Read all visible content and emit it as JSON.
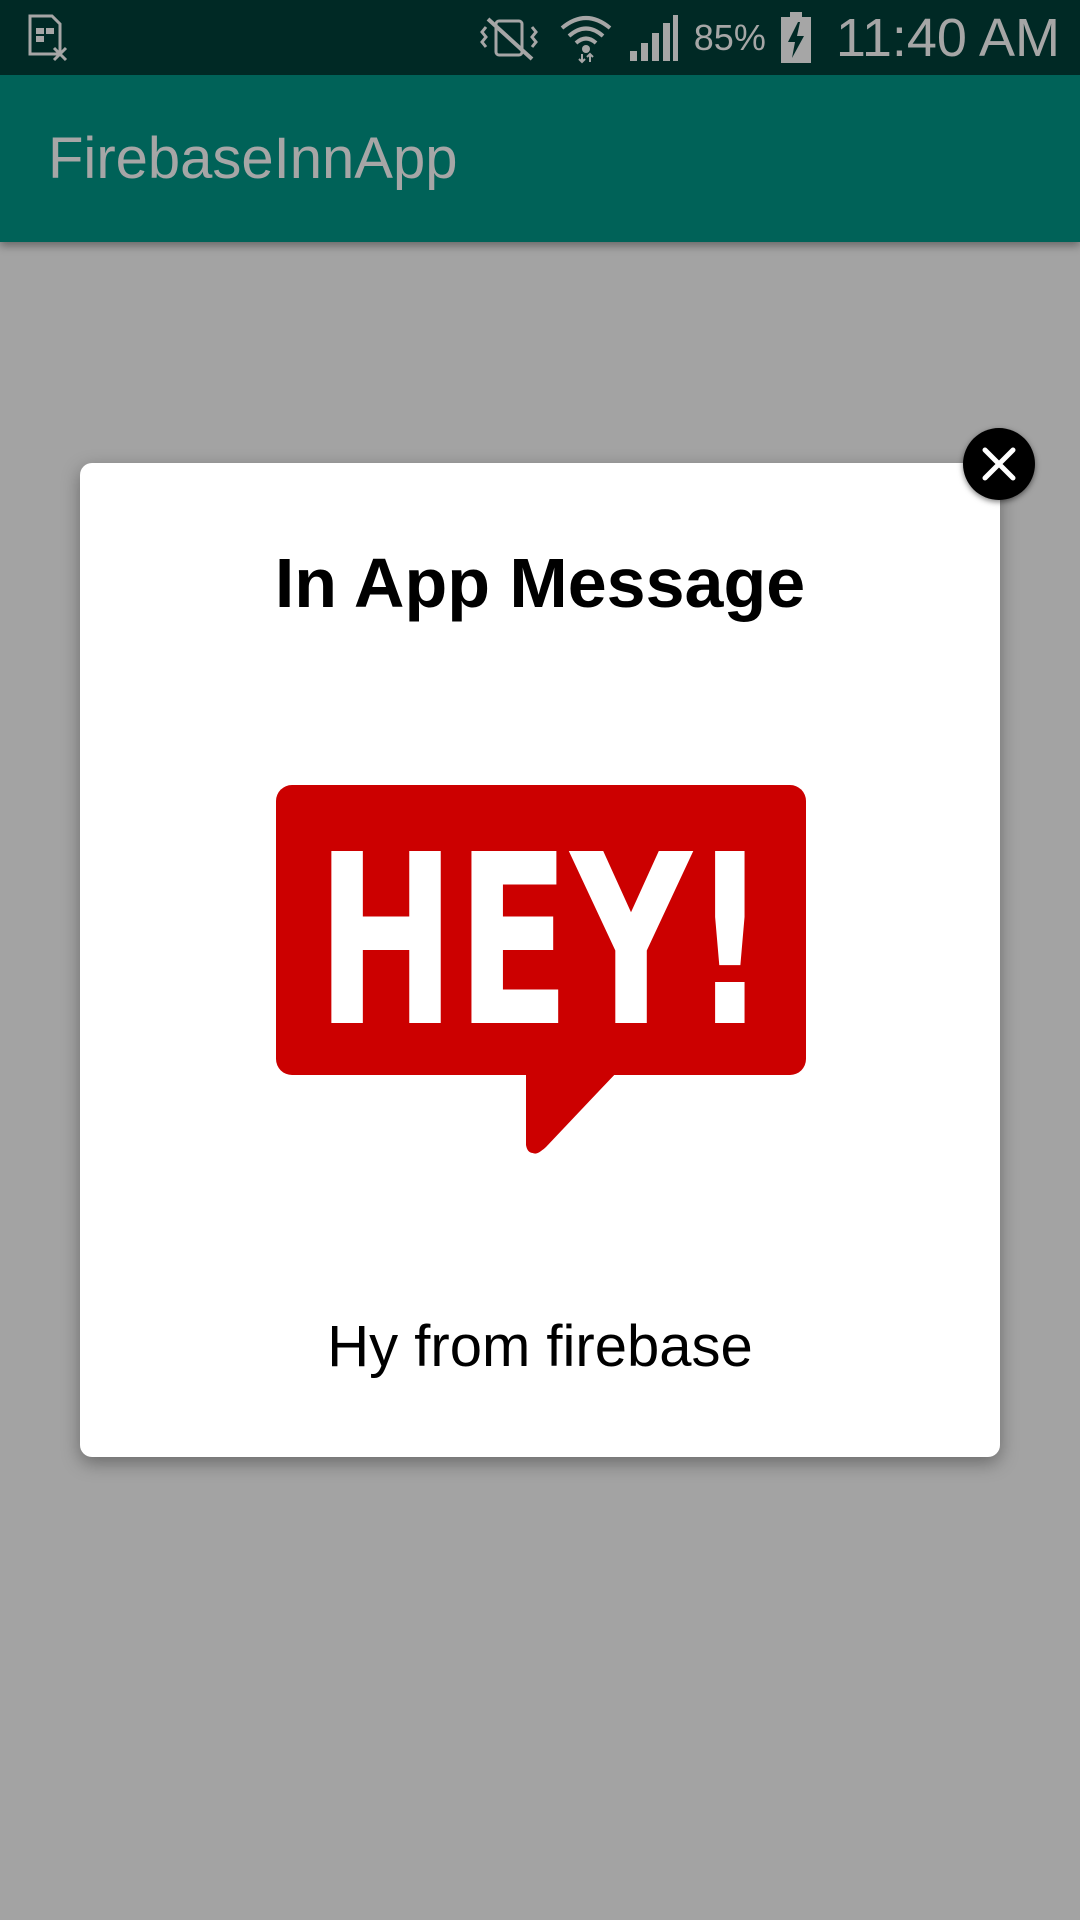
{
  "status_bar": {
    "battery_percent": "85%",
    "time": "11:40 AM",
    "icons": [
      "sim-error-icon",
      "vibrate-mute-icon",
      "wifi-icon",
      "signal-icon",
      "battery-charging-icon"
    ]
  },
  "app_bar": {
    "title": "FirebaseInnApp",
    "color": "#009788"
  },
  "in_app_message": {
    "title": "In App Message",
    "image": {
      "text": "HEY!",
      "icon": "hey-speech-bubble-image",
      "color": "#cc0000"
    },
    "body": "Hy from firebase",
    "close_icon": "close-icon"
  },
  "colors": {
    "status_bar": "#00403a",
    "scrim": "rgba(0,0,0,0.35)",
    "modal_background": "#ffffff"
  }
}
